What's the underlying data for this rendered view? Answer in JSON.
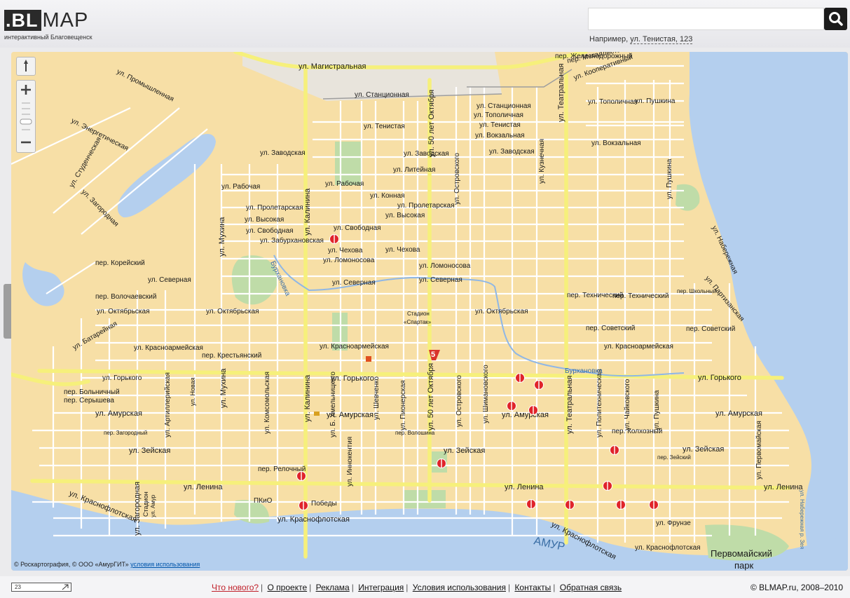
{
  "header": {
    "logo_bl": ".BL",
    "logo_map": "MAP",
    "tagline": "интерактивный Благовещенск",
    "search_placeholder": "",
    "example_prefix": "Например,",
    "example_link": "ул. Тенистая, 123",
    "search_icon": "magnifier-icon"
  },
  "map": {
    "controls": {
      "compass_icon": "compass-icon",
      "zoom_in_icon": "plus-icon",
      "zoom_out_icon": "minus-icon",
      "zoom_slider_icon": "zoom-slider-icon"
    },
    "copyright_text": "© Роскартография, © ООО «АмурГИТ»",
    "copyright_link": "условия использования",
    "water": {
      "river_amur": "АМУР",
      "river_burkhanovka": "Бурхановка"
    },
    "streets": {
      "s01": "ул. Магистральная",
      "s02": "ул. Промышленная",
      "s03": "ул. Энергетическая",
      "s04": "ул. Студенческая",
      "s05": "ул. Загородная",
      "s06": "ул. Станционная",
      "s07": "ул. Станционная",
      "s08": "ул. Тенистая",
      "s09": "ул. Тенистая",
      "s10": "ул. Заводская",
      "s11": "ул. Заводская",
      "s12": "ул. Заводская",
      "s13": "ул. Литейная",
      "s14": "ул. Рабочая",
      "s15": "ул. Рабочая",
      "s16": "ул. Конная",
      "s17": "ул. Пролетарская",
      "s18": "ул. Пролетарская",
      "s19": "ул. Высокая",
      "s20": "ул. Высокая",
      "s21": "ул. Свободная",
      "s22": "ул. Свободная",
      "s23": "ул. Забурхановская",
      "s24": "ул. Чехова",
      "s25": "ул. Чехова",
      "s26": "ул. Ломоносова",
      "s27": "ул. Ломоносова",
      "s28": "ул. Северная",
      "s29": "ул. Северная",
      "s30": "ул. Северная",
      "s31": "ул. Октябрьская",
      "s32": "ул. Октябрьская",
      "s33": "ул. Октябрьская",
      "s34": "ул. Красноармейская",
      "s35": "ул. Красноармейская",
      "s36": "ул. Красноармейская",
      "s37": "пер. Крестьянский",
      "s38": "ул. Горького",
      "s39": "ул. Горького",
      "s40": "ул. Горького",
      "s41": "ул. Амурская",
      "s42": "ул. Амурская",
      "s43": "ул. Амурская",
      "s44": "ул. Амурская",
      "s45": "ул. Зейская",
      "s46": "ул. Зейская",
      "s47": "ул. Зейская",
      "s48": "ул. Ленина",
      "s49": "ул. Ленина",
      "s50": "ул. Ленина",
      "s51": "ул. Краснофлотская",
      "s52": "ул. Краснофлотская",
      "s53": "ул. Краснофлотская",
      "s54": "ул. Краснофлотская",
      "s55": "ул. Калинина",
      "s56": "ул. Калинина",
      "s57": "ул. Мухина",
      "s58": "ул. Мухина",
      "s59": "ул. 50 лет Октября",
      "s60": "ул. 50 лет Октября",
      "s61": "ул. Театральная",
      "s62": "ул. Театральная",
      "s63": "ул. Островского",
      "s64": "ул. Островского",
      "s65": "ул. Шимановского",
      "s66": "ул. Пушкина",
      "s67": "ул. Пушкина",
      "s68": "ул. Чайковского",
      "s69": "ул. Политехническая",
      "s70": "ул. Набережная",
      "s71": "ул. Партизанская",
      "s72": "ул. Первомайская",
      "s73": "ул. Артиллерийская",
      "s74": "ул. Комсомольская",
      "s75": "ул. Пионерская",
      "s76": "ул. Шевченко",
      "s77": "ул. Б. Хмельницкого",
      "s78": "ул. Иннокентия",
      "s79": "пер. Советский",
      "s80": "пер. Советский",
      "s81": "пер. Технический",
      "s82": "пер. Технический",
      "s83": "пер. Колхозный",
      "s84": "пер. Корейский",
      "s85": "пер. Волочаевский",
      "s86": "пер. Больничный",
      "s87": "пер. Серышева",
      "s88": "пер. Загородный",
      "s89": "пер. Релочный",
      "s90": "ул. Фрунзе",
      "s91": "ул. Кузнечная",
      "s92": "ул. Кооперативный",
      "s93": "пер. Металлиста",
      "s94": "пер. Железнодорожный",
      "s95": "ул. Тополичная",
      "s96": "ул. Вокзальная",
      "s97": "ул. Тополичная",
      "s98": "ул. Вокзальная",
      "s99": "ул. Пушкина",
      "s100": "пер. Волошина",
      "s101": "пер. Зейский",
      "s102": "пер. Школьный",
      "s103": "ул. Амур",
      "s104": "ул. Новая",
      "s105": "ул. Батарейная",
      "s106": "ул. Набережная р. Зея",
      "s107": "ул. Загородная"
    },
    "places": {
      "stadium_1": "Стадион",
      "stadium_2": "«Спартак»",
      "pkio": "ПКиО",
      "pobedy": "Победы",
      "park_1": "Первомайский",
      "park_2": "парк",
      "sportivnaya": "Стадион"
    }
  },
  "footer": {
    "scale_text": "23",
    "links": [
      "Что нового?",
      "О проекте",
      "Реклама",
      "Интеграция",
      "Условия использования",
      "Контакты",
      "Обратная связь"
    ],
    "copyright": "© BLMAP.ru, 2008–2010"
  }
}
